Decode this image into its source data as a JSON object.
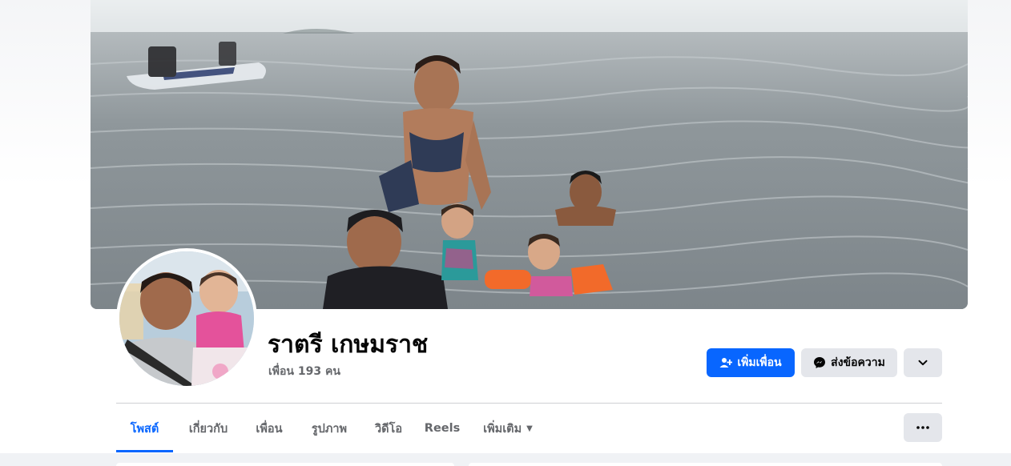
{
  "profile": {
    "name": "ราตรี เกษมราช",
    "friends_count": "เพื่อน 193 คน"
  },
  "actions": {
    "add_friend_label": "เพิ่มเพื่อน",
    "message_label": "ส่งข้อความ"
  },
  "tabs": [
    {
      "label": "โพสต์",
      "active": true
    },
    {
      "label": "เกี่ยวกับ"
    },
    {
      "label": "เพื่อน"
    },
    {
      "label": "รูปภาพ"
    },
    {
      "label": "วิดีโอ"
    },
    {
      "label": "Reels"
    },
    {
      "label": "เพิ่มเติม"
    }
  ],
  "icons": {
    "add_friend": "person-add-icon",
    "message": "messenger-icon",
    "expand": "chevron-down-icon",
    "more_options": "more-horizontal-icon",
    "more_tab_caret": "caret-down-icon"
  },
  "colors": {
    "accent": "#0866ff",
    "text_primary": "#050505",
    "text_secondary": "#65676b",
    "button_secondary": "#e4e6eb"
  }
}
